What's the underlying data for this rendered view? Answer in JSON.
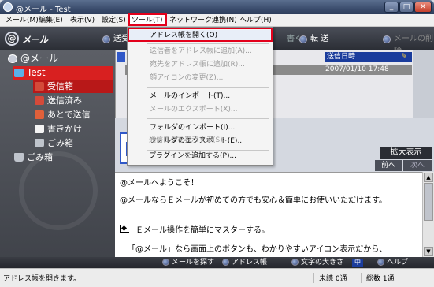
{
  "window": {
    "title": "@メール - Test",
    "min_glyph": "_",
    "max_glyph": "□",
    "close_glyph": "✕"
  },
  "menubar": {
    "mail": "メール(M)",
    "edit": "編集(E)",
    "view": "表示(V)",
    "settings": "設定(S)",
    "tools": "ツール(T)",
    "network": "ネットワーク連携(N)",
    "help": "ヘルプ(H)"
  },
  "toolbar": {
    "logo_mark": "@",
    "logo_text": "メール",
    "send": "送受",
    "reply_all": "書く",
    "forward": "転 送",
    "delete": "メールの削除"
  },
  "folders": {
    "root": "@メール",
    "test": "Test",
    "inbox": "受信箱",
    "sent": "送信済み",
    "later": "あとで送信",
    "draft": "書きかけ",
    "trash_sub": "ごみ箱",
    "trash": "ごみ箱"
  },
  "message_list": {
    "col_date": "送信日時",
    "attach_glyph": "✎",
    "rows": [
      {
        "date": "2007/01/10 17:48"
      }
    ]
  },
  "preview": {
    "expand": "拡大表示",
    "prev": "前へ",
    "next": "次へ",
    "line1": "@メールへようこそ！",
    "line2": "@メールならＥメールが初めての方でも安心＆簡単にお使いいただけます。",
    "line3": "Ｅメール操作を簡単にマスターする。",
    "line4": "「@メール」なら画面上のボタンも、わかりやすいアイコン表示だから、"
  },
  "bottombar": {
    "search": "メールを探す",
    "addressbook": "アドレス帳",
    "fontsize": "文字の大きさ",
    "fontsize_value": "中",
    "help": "ヘルプ"
  },
  "statusbar": {
    "message": "アドレス帳を開きます。",
    "unread": "未読 0通",
    "total": "総数 1通"
  },
  "tools_menu": {
    "items": [
      {
        "label": "アドレス帳を開く(O)",
        "enabled": true
      },
      {
        "label": "送信者をアドレス帳に追加(A)...",
        "enabled": false
      },
      {
        "label": "宛先をアドレス帳に追加(R)...",
        "enabled": false
      },
      {
        "label": "顔アイコンの変更(Z)...",
        "enabled": false
      },
      {
        "label": "メールのインポート(T)...",
        "enabled": true
      },
      {
        "label": "メールのエクスポート(X)...",
        "enabled": false
      },
      {
        "label": "フォルダのインポート(I)...",
        "enabled": true
      },
      {
        "label": "フォルダのエクスポート(E)...",
        "enabled": true
      },
      {
        "label": "通信ログを表示する(S)",
        "enabled": false
      },
      {
        "label": "プラグインを追加する(P)...",
        "enabled": true
      }
    ]
  },
  "colors": {
    "highlight_outline": "#e3001b",
    "selected_folder": "#d82020",
    "header_blue": "#1a3c9c"
  }
}
